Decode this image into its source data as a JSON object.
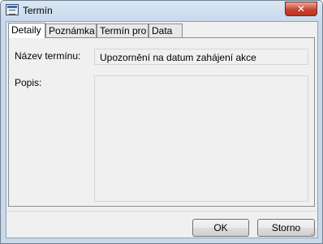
{
  "window": {
    "title": "Termín",
    "icon": "calendar-app-icon",
    "close_glyph": "✕"
  },
  "tabs": [
    {
      "label": "Detaily",
      "active": true
    },
    {
      "label": "Poznámka",
      "active": false
    },
    {
      "label": "Termín pro",
      "active": false
    },
    {
      "label": "Data",
      "active": false
    }
  ],
  "form": {
    "name_label": "Název termínu:",
    "name_value": "Upozornění na datum zahájení akce",
    "description_label": "Popis:",
    "description_value": ""
  },
  "buttons": {
    "ok": "OK",
    "cancel": "Storno"
  }
}
